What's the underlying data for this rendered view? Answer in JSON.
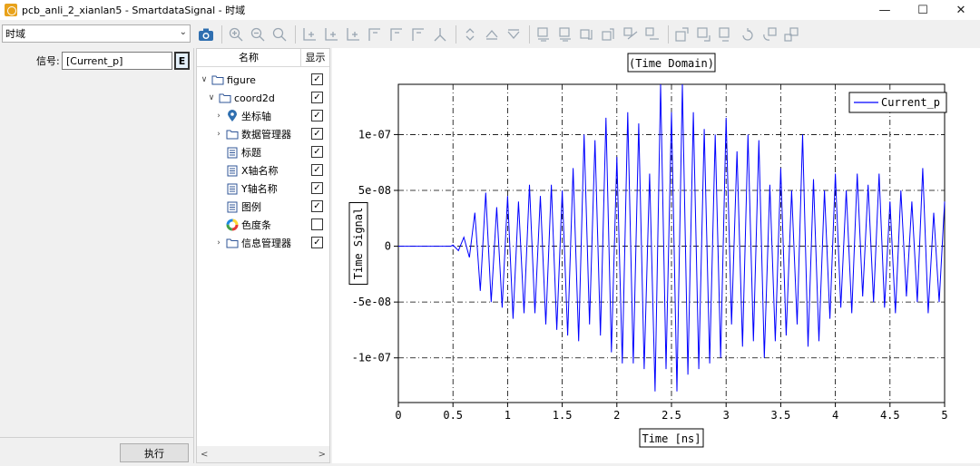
{
  "window": {
    "title": "pcb_anli_2_xianlan5 - SmartdataSignal - 时域",
    "minimize": "—",
    "maximize": "☐",
    "close": "✕"
  },
  "mode_select": {
    "value": "时域"
  },
  "signal": {
    "label": "信号:",
    "value": "[Current_p]",
    "edit_button": "E"
  },
  "run_button": "执行",
  "tree": {
    "header_name": "名称",
    "header_show": "显示",
    "items": [
      {
        "label": "figure",
        "checked": true
      },
      {
        "label": "coord2d",
        "checked": true
      },
      {
        "label": "坐标轴",
        "checked": true
      },
      {
        "label": "数据管理器",
        "checked": true
      },
      {
        "label": "标题",
        "checked": true
      },
      {
        "label": "X轴名称",
        "checked": true
      },
      {
        "label": "Y轴名称",
        "checked": true
      },
      {
        "label": "图例",
        "checked": true
      },
      {
        "label": "色度条",
        "checked": false
      },
      {
        "label": "信息管理器",
        "checked": true
      }
    ],
    "scroll_left": "<",
    "scroll_right": ">"
  },
  "chart_data": {
    "type": "line",
    "title": "(Time Domain)",
    "xlabel": "Time [ns]",
    "ylabel": "Time Signal",
    "xlim": [
      0,
      5
    ],
    "ylim": [
      -1.4e-07,
      1.45e-07
    ],
    "x_ticks": [
      "0",
      "0.5",
      "1",
      "1.5",
      "2",
      "2.5",
      "3",
      "3.5",
      "4",
      "4.5",
      "5"
    ],
    "y_ticks": [
      "1e-07",
      "5e-08",
      "0",
      "-5e-08",
      "-1e-07"
    ],
    "grid": true,
    "legend": "top-right",
    "series": [
      {
        "name": "Current_p",
        "color": "#0000ff",
        "x": [
          0,
          0.25,
          0.48,
          0.5,
          0.55,
          0.6,
          0.65,
          0.7,
          0.75,
          0.8,
          0.85,
          0.9,
          0.95,
          1.0,
          1.05,
          1.1,
          1.15,
          1.2,
          1.25,
          1.3,
          1.35,
          1.4,
          1.45,
          1.5,
          1.55,
          1.6,
          1.65,
          1.7,
          1.75,
          1.8,
          1.85,
          1.9,
          1.95,
          2.0,
          2.05,
          2.1,
          2.15,
          2.2,
          2.25,
          2.3,
          2.35,
          2.4,
          2.45,
          2.5,
          2.55,
          2.6,
          2.65,
          2.7,
          2.75,
          2.8,
          2.85,
          2.9,
          2.95,
          3.0,
          3.05,
          3.1,
          3.15,
          3.2,
          3.25,
          3.3,
          3.35,
          3.4,
          3.45,
          3.5,
          3.55,
          3.6,
          3.65,
          3.7,
          3.75,
          3.8,
          3.85,
          3.9,
          3.95,
          4.0,
          4.05,
          4.1,
          4.15,
          4.2,
          4.25,
          4.3,
          4.35,
          4.4,
          4.45,
          4.5,
          4.55,
          4.6,
          4.65,
          4.7,
          4.75,
          4.8,
          4.85,
          4.9,
          4.95,
          5.0
        ],
        "y": [
          0,
          0,
          0,
          1e-09,
          -4e-09,
          8e-09,
          -1e-08,
          3e-08,
          -4e-08,
          4.8e-08,
          -5e-08,
          3.5e-08,
          -5.5e-08,
          4.5e-08,
          -6.5e-08,
          4e-08,
          -6e-08,
          5.5e-08,
          -6e-08,
          4.5e-08,
          -7e-08,
          5.5e-08,
          -7.5e-08,
          5e-08,
          -8e-08,
          7e-08,
          -8.5e-08,
          1e-07,
          -7e-08,
          9.5e-08,
          -8e-08,
          1.15e-07,
          -9.5e-08,
          8e-08,
          -1.05e-07,
          1.2e-07,
          -1.05e-07,
          1.1e-07,
          -1.1e-07,
          6.5e-08,
          -1.3e-07,
          1.45e-07,
          -1.1e-07,
          1.2e-07,
          -1.3e-07,
          1.45e-07,
          -1.15e-07,
          1.2e-07,
          -1.1e-07,
          1.05e-07,
          -1.05e-07,
          1e-07,
          -1e-07,
          1.15e-07,
          -7e-08,
          8.5e-08,
          -9e-08,
          1e-07,
          -8.5e-08,
          9.5e-08,
          -1e-07,
          5.5e-08,
          -8.5e-08,
          7e-08,
          -8e-08,
          5e-08,
          -7e-08,
          1e-07,
          -9e-08,
          6e-08,
          -8.5e-08,
          5e-08,
          -6.5e-08,
          6.5e-08,
          -5.5e-08,
          5e-08,
          -6e-08,
          6.5e-08,
          -4.5e-08,
          5.5e-08,
          -5e-08,
          6.5e-08,
          -5.5e-08,
          4e-08,
          -6e-08,
          5e-08,
          -4.5e-08,
          4e-08,
          -5e-08,
          7e-08,
          -6e-08,
          3e-08,
          -5e-08,
          4e-08
        ]
      }
    ]
  }
}
